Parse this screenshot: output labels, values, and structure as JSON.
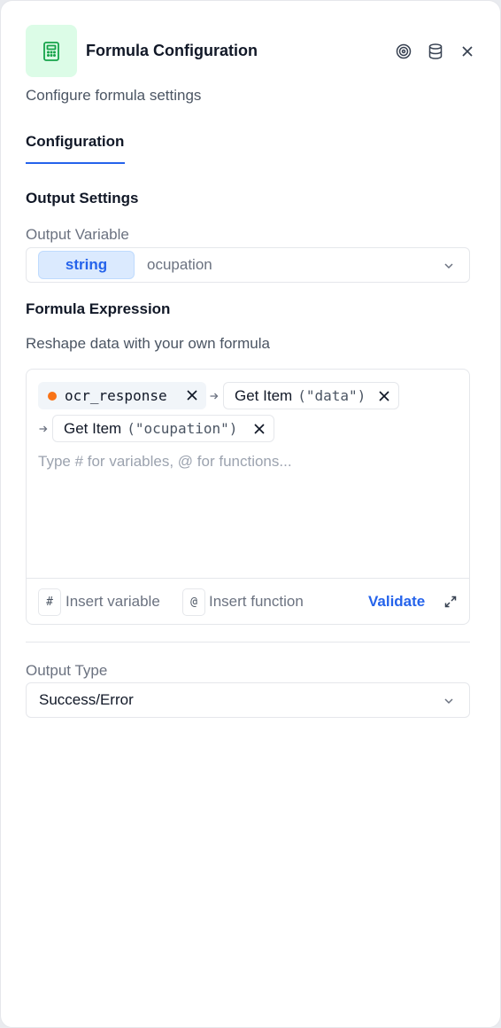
{
  "header": {
    "title": "Formula Configuration",
    "subtitle": "Configure formula settings",
    "icons": [
      "calculator-icon",
      "target-icon",
      "database-icon",
      "close-icon"
    ]
  },
  "tabs": [
    {
      "label": "Configuration",
      "active": true
    }
  ],
  "output_settings": {
    "title": "Output Settings",
    "output_variable_label": "Output Variable",
    "type_badge": "string",
    "variable_name": "ocupation"
  },
  "formula": {
    "title": "Formula Expression",
    "description": "Reshape data with your own formula",
    "chips": [
      {
        "kind": "variable",
        "label": "ocr_response"
      },
      {
        "kind": "function",
        "name": "Get Item",
        "args": "(\"data\")"
      },
      {
        "kind": "function",
        "name": "Get Item",
        "args": "(\"ocupation\")"
      }
    ],
    "placeholder": "Type # for variables, @ for functions...",
    "insert_variable_key": "#",
    "insert_variable_label": "Insert variable",
    "insert_function_key": "@",
    "insert_function_label": "Insert function",
    "validate_label": "Validate"
  },
  "output_type": {
    "label": "Output Type",
    "value": "Success/Error"
  },
  "colors": {
    "accent": "#2563eb",
    "icon_bg": "#dcfce7",
    "icon_fg": "#16a34a",
    "variable_dot": "#f97316"
  }
}
